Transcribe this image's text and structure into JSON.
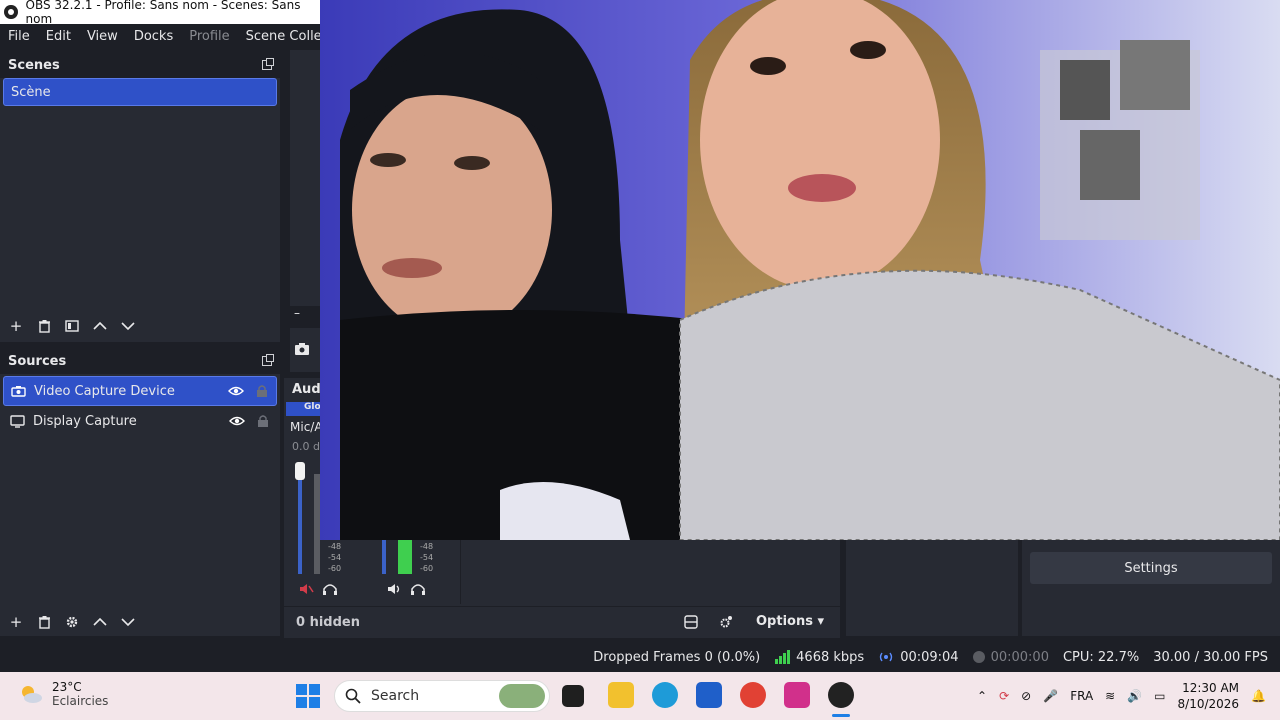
{
  "window": {
    "title": "OBS 32.2.1 - Profile: Sans nom - Scenes: Sans nom"
  },
  "menu": {
    "file": "File",
    "edit": "Edit",
    "view": "View",
    "docks": "Docks",
    "profile": "Profile",
    "scene_collection": "Scene Collectio"
  },
  "scenes": {
    "title": "Scenes",
    "items": [
      {
        "label": "Scène"
      }
    ]
  },
  "sources": {
    "title": "Sources",
    "items": [
      {
        "label": "Video Capture Device",
        "icon": "camera-icon"
      },
      {
        "label": "Display Capture",
        "icon": "monitor-icon"
      }
    ],
    "hidden_count": "0 hidden"
  },
  "mixer": {
    "title": "Audi",
    "tag": "Glo",
    "channel": "Mic/A",
    "db": "0.0 d",
    "scale": [
      "-48",
      "-54",
      "-60"
    ],
    "options_label": "Options"
  },
  "controls": {
    "settings_label": "Settings"
  },
  "status": {
    "dropped_frames": "Dropped Frames 0 (0.0%)",
    "bitrate": "4668 kbps",
    "record_time": "00:09:04",
    "stream_time": "00:00:00",
    "cpu": "CPU: 22.7%",
    "fps": "30.00 / 30.00 FPS"
  },
  "taskbar": {
    "weather_temp": "23°C",
    "weather_desc": "Eclaircies",
    "search_placeholder": "Search",
    "language": "FRA",
    "time": "12:30 AM",
    "date": "8/10/2026"
  },
  "colors": {
    "accent": "#2f51c8",
    "bitrate_bar": "#3fcf4f",
    "mic_muted": "#d23c4a"
  }
}
